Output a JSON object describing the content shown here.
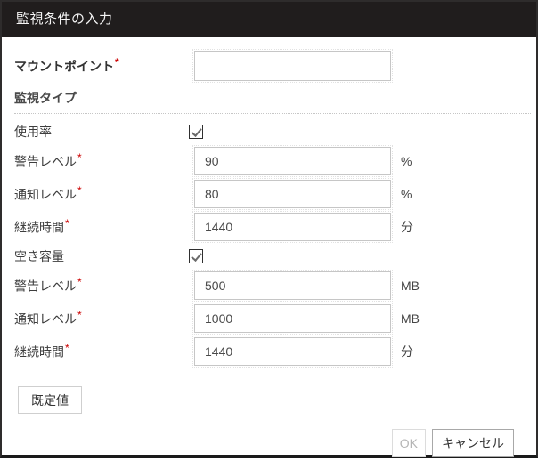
{
  "dialog": {
    "title": "監視条件の入力",
    "required_marker": "*",
    "mount_point": {
      "label": "マウントポイント",
      "value": ""
    },
    "section_label": "監視タイプ",
    "groups": [
      {
        "checkbox_label": "使用率",
        "checkbox_checked": true,
        "fields": [
          {
            "label": "警告レベル",
            "value": "90",
            "unit": "%"
          },
          {
            "label": "通知レベル",
            "value": "80",
            "unit": "%"
          },
          {
            "label": "継続時間",
            "value": "1440",
            "unit": "分"
          }
        ]
      },
      {
        "checkbox_label": "空き容量",
        "checkbox_checked": true,
        "fields": [
          {
            "label": "警告レベル",
            "value": "500",
            "unit": "MB"
          },
          {
            "label": "通知レベル",
            "value": "1000",
            "unit": "MB"
          },
          {
            "label": "継続時間",
            "value": "1440",
            "unit": "分"
          }
        ]
      }
    ],
    "buttons": {
      "default": "既定値",
      "ok": "OK",
      "cancel": "キャンセル"
    },
    "ok_enabled": false,
    "colors": {
      "title_bar": "#201d1d",
      "required_asterisk": "#cc0000",
      "input_border": "#c6c6c6"
    }
  }
}
